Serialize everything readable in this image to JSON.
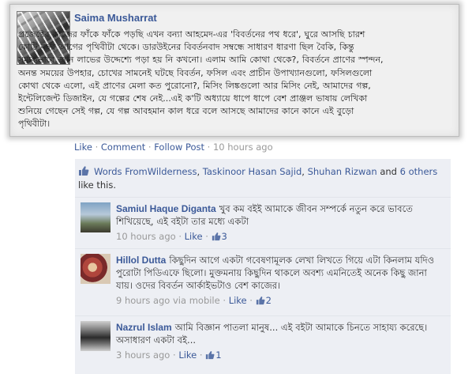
{
  "post": {
    "author": "Saima Musharrat",
    "lines": [
      "প্রজেক্টের কাজের ফাঁকে ফাঁকে পড়ছি এখন বন্যা আহমেদ-এর 'বিবর্তনের পথ ধরে', ঘুরে আসছি চারশ",
      "কোটি বছর আগের পৃথিবীটা থেকে। ডারউইনের বিবর্তনবাদ সম্বন্ধে সাধারণ ধারণা ছিল বৈকি, কিন্তু",
      "সম্যকভাবে জ্ঞান লাভের উদ্দেশ্যে পড়া হয় নি কখনো। এলাম আমি কোথা থেকে?, বিবর্তনে প্রাণের স্পন্দন,",
      "অনন্ত সময়ের উপহার, চোখের সামনেই ঘটছে বিবর্তন, ফসিল এবং প্রাচীন উপাখ্যানগুলো, ফসিলগুলো",
      "কোথা থেকে এলো, এই প্রাণের মেলা কত পুরোনো?, মিসিং লিঙ্কগুলো আর মিসিং নেই, আমাদের গল্প,",
      "ইন্টেলিজেন্ট ডিজাইন, যে গল্পের শেষ নেই...এই ক'টি অধ্যায়ে ধাপে ধাপে বেশ প্রাঞ্জল ভাষায় লেখিকা",
      "শুনিয়ে গেছেন সেই গল্প, যে গল্প আবহমান কাল ধরে বলে আসছে আমাদের কানে কানে এই বুড়ো",
      "পৃথিবীটা।"
    ]
  },
  "post_actions": {
    "like": "Like",
    "sep1": " · ",
    "comment": "Comment",
    "sep2": " · ",
    "follow": "Follow Post",
    "sep3": " · ",
    "time": "10 hours ago"
  },
  "likes": {
    "name1": "Words FromWilderness",
    "sep1": ", ",
    "name2": "Taskinoor Hasan Sajid",
    "sep2": ", ",
    "name3": "Shuhan Rizwan",
    "and_text": " and ",
    "others": "6 others",
    "suffix": " like this."
  },
  "comments": [
    {
      "name": "Samiul Haque Diganta",
      "text": "খুব কম বইই আমাকে জীবন সম্পর্কে নতুন করে ভাবতে শিখিয়েছে, এই বইটা তার মধ্যে একটা",
      "time": "10 hours ago",
      "via": "",
      "like": "Like",
      "count": "3"
    },
    {
      "name": "Hillol Dutta",
      "text": "কিছুদিন আগে একটা গবেষণামূলক লেখা লিখতে গিয়ে এটা কিনলাম যদিও পুরোটা পিডিএফে ছিলো। মুক্তমনায় কিছুদিন থাকলে অবশ্য এমনিতেই অনেক কিছু জানা যায়। ওদের বিবর্তন আর্কাইভটাও বেশ কাজের।",
      "time": "9 hours ago",
      "via": " via mobile",
      "like": "Like",
      "count": "2"
    },
    {
      "name": "Nazrul Islam",
      "text": "আমি বিজ্ঞান পাতলা মানুষ... এই বইটা আমাকে চিনতে সাহায্য করেছে। অসাধারণ একটা বই...",
      "time": "3 hours ago",
      "via": "",
      "like": "Like",
      "count": "1"
    }
  ],
  "meta_sep": " · ",
  "colors": {
    "link": "#3b5998",
    "meta_gray": "#999999",
    "comments_bg": "#edeff4",
    "post_bg": "#f0f0f0"
  },
  "icons": {
    "like_summary": "thumbs-up-icon",
    "comment_like": "thumbs-up-icon"
  }
}
